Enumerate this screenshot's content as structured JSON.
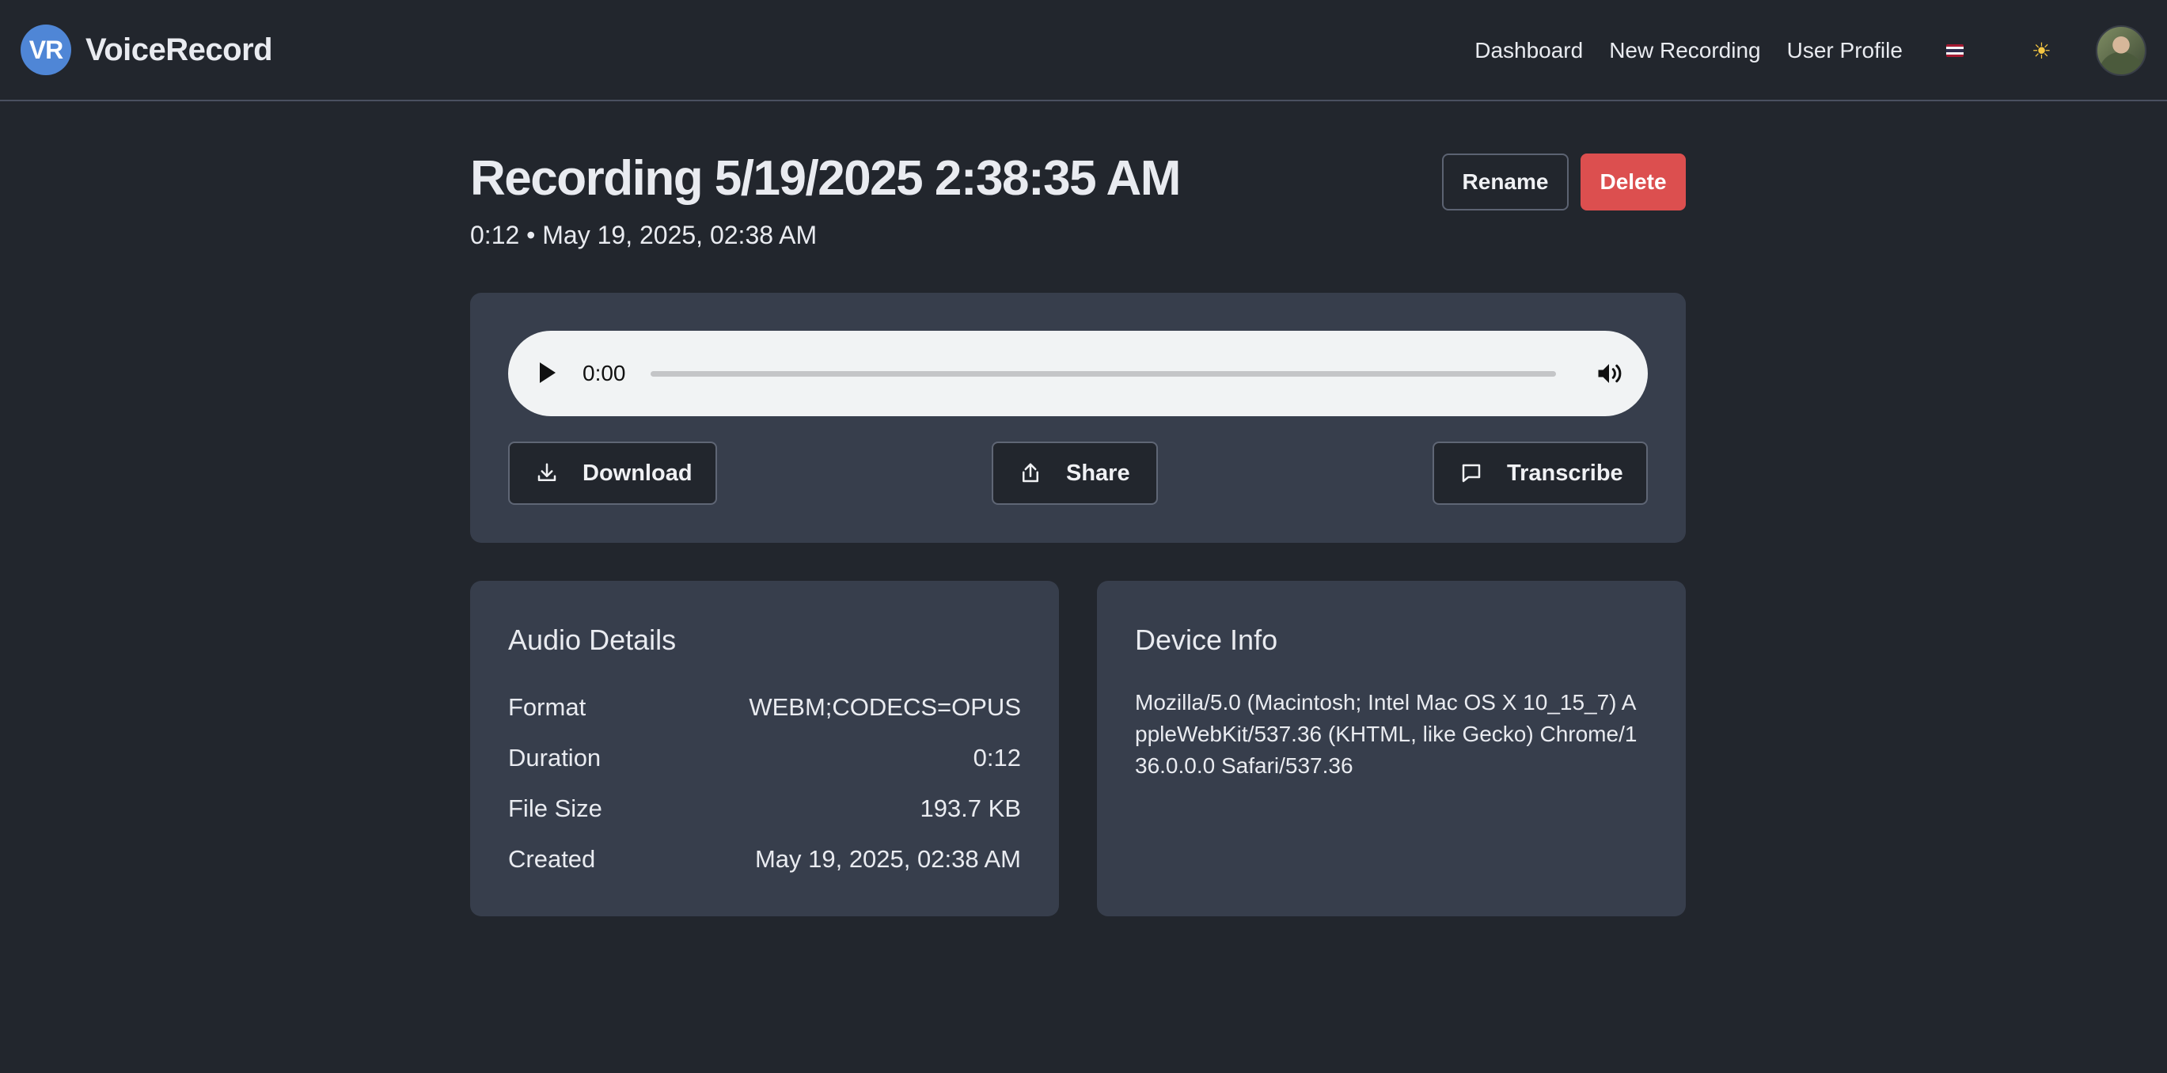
{
  "app": {
    "badge": "VR",
    "name": "VoiceRecord"
  },
  "nav": {
    "links": [
      "Dashboard",
      "New Recording",
      "User Profile"
    ],
    "language_icon": "thai-flag-icon",
    "theme_icon": "sun-icon",
    "avatar_icon": "user-avatar"
  },
  "recording": {
    "title": "Recording 5/19/2025 2:38:35 AM",
    "subtitle": "0:12 • May 19, 2025, 02:38 AM",
    "rename_label": "Rename",
    "delete_label": "Delete"
  },
  "player": {
    "current_time": "0:00",
    "progress": 0
  },
  "actions": {
    "download_label": "Download",
    "share_label": "Share",
    "transcribe_label": "Transcribe"
  },
  "audio_details": {
    "title": "Audio Details",
    "rows": [
      {
        "label": "Format",
        "value": "WEBM;CODECS=OPUS"
      },
      {
        "label": "Duration",
        "value": "0:12"
      },
      {
        "label": "File Size",
        "value": "193.7 KB"
      },
      {
        "label": "Created",
        "value": "May 19, 2025, 02:38 AM"
      }
    ]
  },
  "device_info": {
    "title": "Device Info",
    "user_agent": "Mozilla/5.0 (Macintosh; Intel Mac OS X 10_15_7) AppleWebKit/537.36 (KHTML, like Gecko) Chrome/136.0.0.0 Safari/537.36"
  },
  "colors": {
    "background": "#22262d",
    "card": "#373e4c",
    "accent": "#4f86d6",
    "danger": "#dc4f4f"
  }
}
